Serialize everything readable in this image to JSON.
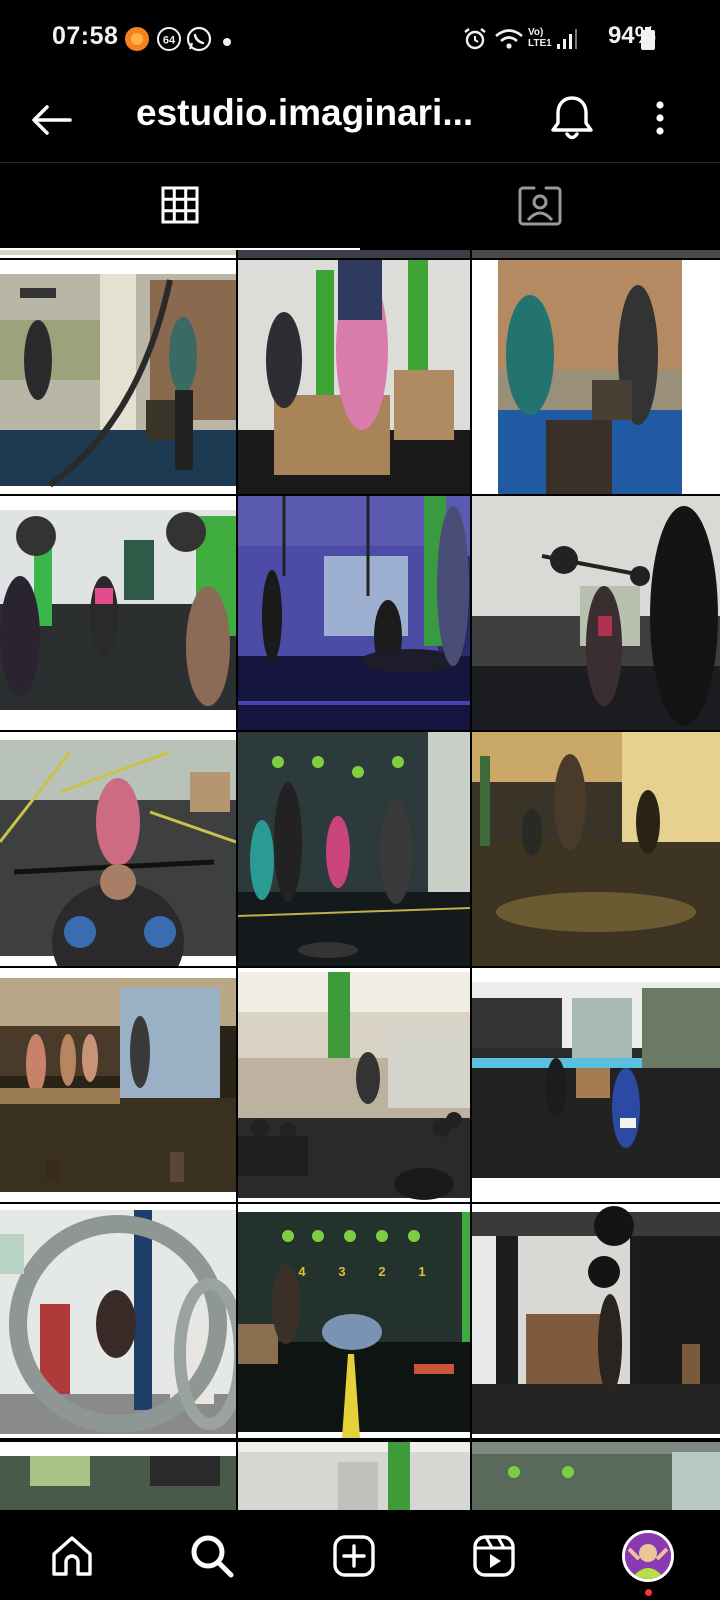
{
  "status_bar": {
    "time": "07:58",
    "notification_badge": "64",
    "network_label": "Vo) LTE1",
    "battery": "94%"
  },
  "header": {
    "title": "estudio.imaginari...",
    "icons": [
      "back-arrow-icon",
      "bell-icon",
      "more-vertical-icon"
    ]
  },
  "tabs": [
    {
      "name": "grid-posts",
      "icon": "grid-icon",
      "active": true
    },
    {
      "name": "tagged",
      "icon": "tagged-user-icon",
      "active": false
    }
  ],
  "grid": {
    "columns": 3,
    "rows": [
      [
        "photo-battle-ropes-box",
        "photo-box-jump-women",
        "photo-box-jump-pair"
      ],
      [
        "photo-barbell-overhead-class",
        "photo-rings-and-pushups",
        "photo-barbell-silhouette"
      ],
      [
        "photo-overhead-squat-floor",
        "photo-wall-ball-class",
        "photo-yellow-toned-room"
      ],
      [
        "photo-group-class-boxes",
        "photo-gym-kettlebells",
        "photo-runner-window"
      ],
      [
        "photo-rings-frame",
        "photo-pushup-numbers-wall",
        "photo-wall-ball-window"
      ]
    ],
    "wall_numbers": [
      "4",
      "3",
      "2",
      "1"
    ]
  },
  "bottom_nav": [
    {
      "name": "home",
      "icon": "home-icon"
    },
    {
      "name": "search",
      "icon": "search-icon",
      "active": true
    },
    {
      "name": "create",
      "icon": "plus-square-icon"
    },
    {
      "name": "reels",
      "icon": "reels-icon"
    },
    {
      "name": "profile",
      "icon": "avatar"
    }
  ],
  "colors": {
    "background": "#000000",
    "notification_dot": "#ff3040",
    "tab_indicator": "#ffffff"
  }
}
